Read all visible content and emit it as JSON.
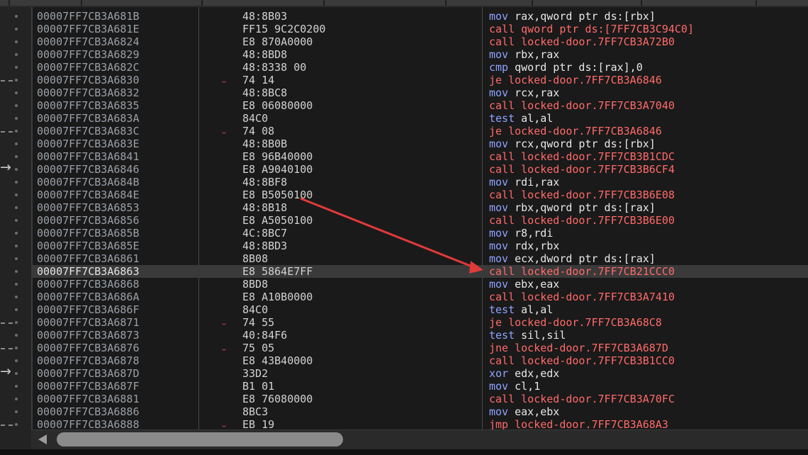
{
  "rows": [
    {
      "addr": "00007FF7CB3A681B",
      "bytes": "48:8B03",
      "m": "mov",
      "ops": "rax,qword ptr ds:[rbx]",
      "kind": "mov",
      "gutter": "dot"
    },
    {
      "addr": "00007FF7CB3A681E",
      "bytes": "FF15 9C2C0200",
      "m": "call",
      "ops": "qword ptr ds:[7FF7CB3C94C0]",
      "kind": "call",
      "gutter": "dot"
    },
    {
      "addr": "00007FF7CB3A6824",
      "bytes": "E8 870A0000",
      "m": "call",
      "ops": "locked-door.7FF7CB3A72B0",
      "kind": "call",
      "gutter": "dot"
    },
    {
      "addr": "00007FF7CB3A6829",
      "bytes": "48:8BD8",
      "m": "mov",
      "ops": "rbx,rax",
      "kind": "mov",
      "gutter": "dot"
    },
    {
      "addr": "00007FF7CB3A682C",
      "bytes": "48:8338 00",
      "m": "cmp",
      "ops": "qword ptr ds:[rax],0",
      "kind": "cmp",
      "gutter": "dot"
    },
    {
      "addr": "00007FF7CB3A6830",
      "bytes": "74 14",
      "m": "je",
      "ops": "locked-door.7FF7CB3A6846",
      "kind": "jmp",
      "gutter": "dash",
      "jump": true
    },
    {
      "addr": "00007FF7CB3A6832",
      "bytes": "48:8BC8",
      "m": "mov",
      "ops": "rcx,rax",
      "kind": "mov",
      "gutter": "dot"
    },
    {
      "addr": "00007FF7CB3A6835",
      "bytes": "E8 06080000",
      "m": "call",
      "ops": "locked-door.7FF7CB3A7040",
      "kind": "call",
      "gutter": "dot"
    },
    {
      "addr": "00007FF7CB3A683A",
      "bytes": "84C0",
      "m": "test",
      "ops": "al,al",
      "kind": "test",
      "gutter": "dot"
    },
    {
      "addr": "00007FF7CB3A683C",
      "bytes": "74 08",
      "m": "je",
      "ops": "locked-door.7FF7CB3A6846",
      "kind": "jmp",
      "gutter": "dash",
      "jump": true
    },
    {
      "addr": "00007FF7CB3A683E",
      "bytes": "48:8B0B",
      "m": "mov",
      "ops": "rcx,qword ptr ds:[rbx]",
      "kind": "mov",
      "gutter": "dot"
    },
    {
      "addr": "00007FF7CB3A6841",
      "bytes": "E8 96B40000",
      "m": "call",
      "ops": "locked-door.7FF7CB3B1CDC",
      "kind": "call",
      "gutter": "dot"
    },
    {
      "addr": "00007FF7CB3A6846",
      "bytes": "E8 A9040100",
      "m": "call",
      "ops": "locked-door.7FF7CB3B6CF4",
      "kind": "call",
      "gutter": "arrow"
    },
    {
      "addr": "00007FF7CB3A684B",
      "bytes": "48:8BF8",
      "m": "mov",
      "ops": "rdi,rax",
      "kind": "mov",
      "gutter": "dot"
    },
    {
      "addr": "00007FF7CB3A684E",
      "bytes": "E8 B5050100",
      "m": "call",
      "ops": "locked-door.7FF7CB3B6E08",
      "kind": "call",
      "gutter": "dot"
    },
    {
      "addr": "00007FF7CB3A6853",
      "bytes": "48:8B18",
      "m": "mov",
      "ops": "rbx,qword ptr ds:[rax]",
      "kind": "mov",
      "gutter": "dot"
    },
    {
      "addr": "00007FF7CB3A6856",
      "bytes": "E8 A5050100",
      "m": "call",
      "ops": "locked-door.7FF7CB3B6E00",
      "kind": "call",
      "gutter": "dot"
    },
    {
      "addr": "00007FF7CB3A685B",
      "bytes": "4C:8BC7",
      "m": "mov",
      "ops": "r8,rdi",
      "kind": "mov",
      "gutter": "dot"
    },
    {
      "addr": "00007FF7CB3A685E",
      "bytes": "48:8BD3",
      "m": "mov",
      "ops": "rdx,rbx",
      "kind": "mov",
      "gutter": "dot"
    },
    {
      "addr": "00007FF7CB3A6861",
      "bytes": "8B08",
      "m": "mov",
      "ops": "ecx,dword ptr ds:[rax]",
      "kind": "mov",
      "gutter": "dot"
    },
    {
      "addr": "00007FF7CB3A6863",
      "bytes": "E8 5864E7FF",
      "m": "call",
      "ops": "locked-door.7FF7CB21CCC0",
      "kind": "call",
      "gutter": "dot",
      "selected": true
    },
    {
      "addr": "00007FF7CB3A6868",
      "bytes": "8BD8",
      "m": "mov",
      "ops": "ebx,eax",
      "kind": "mov",
      "gutter": "dot"
    },
    {
      "addr": "00007FF7CB3A686A",
      "bytes": "E8 A10B0000",
      "m": "call",
      "ops": "locked-door.7FF7CB3A7410",
      "kind": "call",
      "gutter": "dot"
    },
    {
      "addr": "00007FF7CB3A686F",
      "bytes": "84C0",
      "m": "test",
      "ops": "al,al",
      "kind": "test",
      "gutter": "dot"
    },
    {
      "addr": "00007FF7CB3A6871",
      "bytes": "74 55",
      "m": "je",
      "ops": "locked-door.7FF7CB3A68C8",
      "kind": "jmp",
      "gutter": "dash",
      "jump": true
    },
    {
      "addr": "00007FF7CB3A6873",
      "bytes": "40:84F6",
      "m": "test",
      "ops": "sil,sil",
      "kind": "test",
      "gutter": "dot"
    },
    {
      "addr": "00007FF7CB3A6876",
      "bytes": "75 05",
      "m": "jne",
      "ops": "locked-door.7FF7CB3A687D",
      "kind": "jmp",
      "gutter": "dash",
      "jump": true
    },
    {
      "addr": "00007FF7CB3A6878",
      "bytes": "E8 43B40000",
      "m": "call",
      "ops": "locked-door.7FF7CB3B1CC0",
      "kind": "call",
      "gutter": "dot"
    },
    {
      "addr": "00007FF7CB3A687D",
      "bytes": "33D2",
      "m": "xor",
      "ops": "edx,edx",
      "kind": "xor",
      "gutter": "arrow"
    },
    {
      "addr": "00007FF7CB3A687F",
      "bytes": "B1 01",
      "m": "mov",
      "ops": "cl,1",
      "kind": "mov",
      "gutter": "dot"
    },
    {
      "addr": "00007FF7CB3A6881",
      "bytes": "E8 76080000",
      "m": "call",
      "ops": "locked-door.7FF7CB3A70FC",
      "kind": "call",
      "gutter": "dot"
    },
    {
      "addr": "00007FF7CB3A6886",
      "bytes": "8BC3",
      "m": "mov",
      "ops": "eax,ebx",
      "kind": "mov",
      "gutter": "dot"
    },
    {
      "addr": "00007FF7CB3A6888",
      "bytes": "EB 19",
      "m": "jmp",
      "ops": "locked-door.7FF7CB3A68A3",
      "kind": "jmp",
      "gutter": "dash",
      "jump": true
    }
  ],
  "icons": {
    "jump": "chevron-down-icon",
    "branch_target": "arrow-right-icon",
    "scroll_left": "triangle-left-icon"
  },
  "colors": {
    "call": "#ff6a6a",
    "mov": "#8fa3ff",
    "annotation_arrow": "#e03a3a",
    "selected_row": "#3a3a3a"
  }
}
